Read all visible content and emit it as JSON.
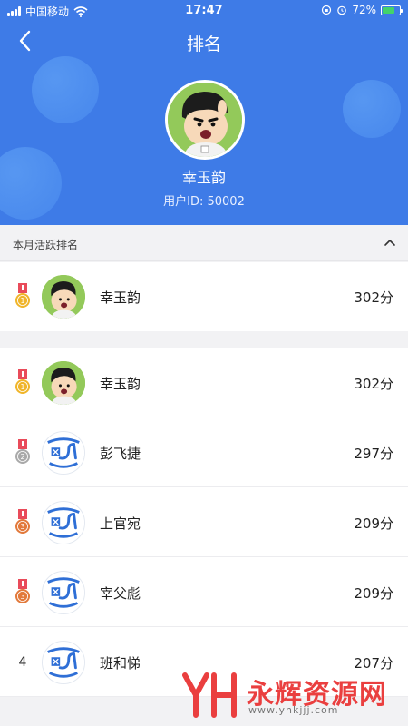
{
  "status_bar": {
    "carrier": "中国移动",
    "time": "17:47",
    "battery": "72%",
    "battery_level": 0.72
  },
  "header": {
    "title": "排名",
    "back_icon": "chevron-left-icon"
  },
  "profile": {
    "name": "幸玉韵",
    "user_id": "用户ID: 50002",
    "avatar": "cartoon-boy-avatar"
  },
  "section": {
    "label": "本月活跃排名",
    "toggle_icon": "chevron-up-icon"
  },
  "my_rank": {
    "rank": "1",
    "medal": "gold-medal-icon",
    "name": "幸玉韵",
    "score": "302分",
    "avatar": "cartoon-boy-avatar"
  },
  "rankings": [
    {
      "rank": "1",
      "medal": "gold-medal-icon",
      "name": "幸玉韵",
      "score": "302分",
      "avatar": "cartoon-boy-avatar"
    },
    {
      "rank": "2",
      "medal": "silver-medal-icon",
      "name": "彭飞捷",
      "score": "297分",
      "avatar": "app-logo-avatar"
    },
    {
      "rank": "3",
      "medal": "bronze-medal-icon",
      "name": "上官宛",
      "score": "209分",
      "avatar": "app-logo-avatar"
    },
    {
      "rank": "3",
      "medal": "bronze-medal-icon",
      "name": "宰父彪",
      "score": "209分",
      "avatar": "app-logo-avatar"
    },
    {
      "rank": "4",
      "medal": "",
      "name": "班和悌",
      "score": "207分",
      "avatar": "app-logo-avatar"
    }
  ],
  "watermark": {
    "logo": "YH",
    "text": "永辉资源网",
    "url": "www.yhkjjj.com"
  },
  "colors": {
    "header_blue": "#3e7be7",
    "gold": "#f0b52a",
    "silver": "#a9a9a9",
    "bronze": "#e2793b",
    "ribbon": "#e94b5a",
    "watermark_red": "#ea3f3f"
  }
}
